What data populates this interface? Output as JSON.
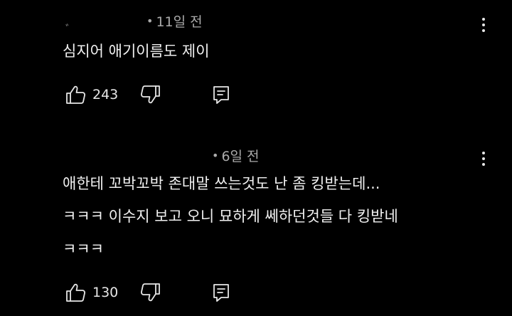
{
  "comments": [
    {
      "author_masked": "ﾞ",
      "time": "11일 전",
      "lines": [
        "심지어 애기이름도 제이"
      ],
      "likes": "243"
    },
    {
      "time": "6일 전",
      "lines": [
        "애한테 꼬박꼬박 존대말 쓰는것도 난 좀 킹받는데...",
        "ㅋㅋㅋ  이수지 보고 오니 묘하게 쎄하던것들  다 킹받네",
        "ㅋㅋㅋ"
      ],
      "likes": "130"
    }
  ],
  "icons": {
    "like": "thumbs-up-icon",
    "dislike": "thumbs-down-icon",
    "reply": "reply-icon",
    "menu": "more-vertical-icon",
    "dot": "•"
  },
  "colors": {
    "background": "#000000",
    "text": "#f1f1f1",
    "meta": "#aaaaaa"
  }
}
